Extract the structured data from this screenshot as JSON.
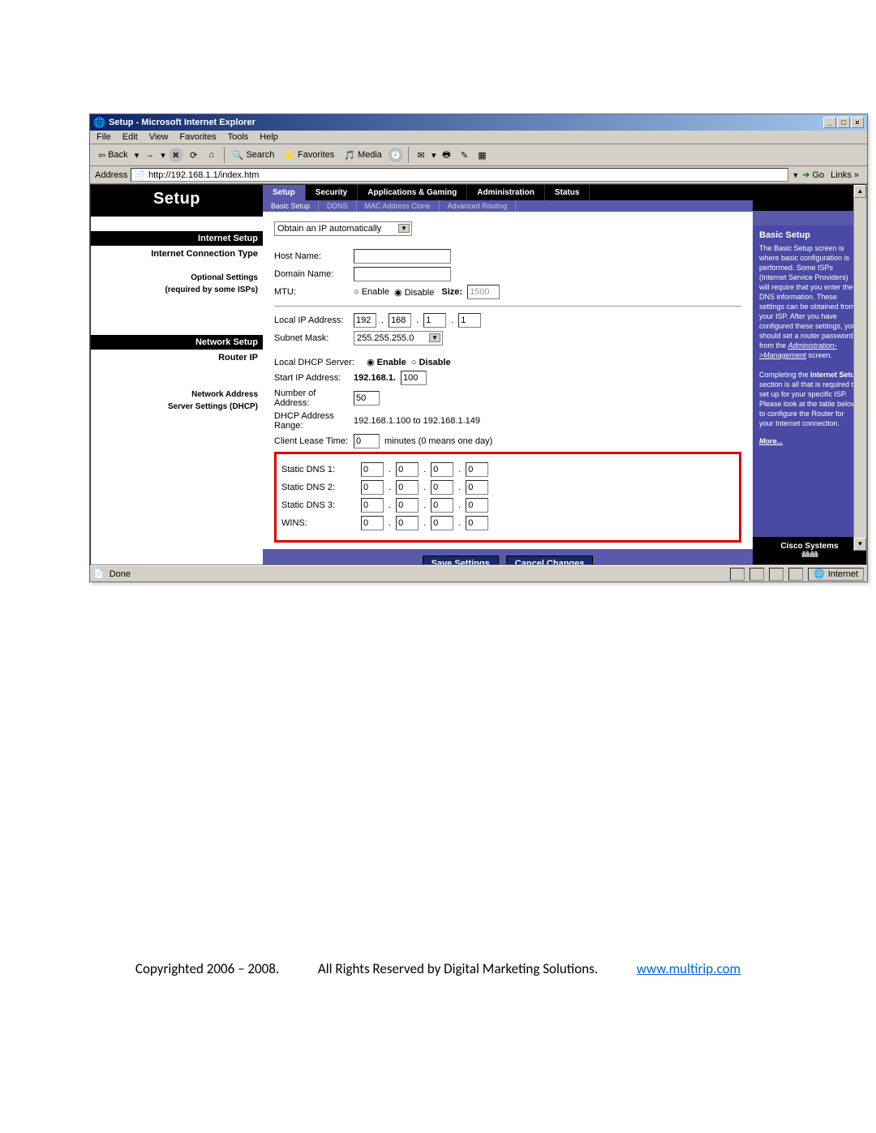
{
  "window": {
    "title": "Setup - Microsoft Internet Explorer",
    "min": "_",
    "max": "□",
    "close": "×"
  },
  "menu": {
    "file": "File",
    "edit": "Edit",
    "view": "View",
    "favorites": "Favorites",
    "tools": "Tools",
    "help": "Help"
  },
  "toolbar": {
    "back": "Back",
    "search": "Search",
    "favorites": "Favorites",
    "media": "Media"
  },
  "address": {
    "label": "Address",
    "url": "http://192.168.1.1/index.htm",
    "go": "Go",
    "links": "Links »"
  },
  "left": {
    "setup": "Setup",
    "internet_setup": "Internet Setup",
    "conn_type": "Internet Connection Type",
    "optional": "Optional Settings",
    "optional2": "(required by some ISPs)",
    "network_setup": "Network Setup",
    "router_ip": "Router IP",
    "net_addr": "Network Address",
    "dhcp": "Server Settings (DHCP)"
  },
  "tabs": {
    "setup": "Setup",
    "security": "Security",
    "apps": "Applications & Gaming",
    "admin": "Administration",
    "status": "Status"
  },
  "subtabs": {
    "basic": "Basic Setup",
    "ddns": "DDNS",
    "mac": "MAC Address Clone",
    "adv": "Advanced Routing"
  },
  "mid": {
    "obtain": "Obtain an IP automatically",
    "host": "Host Name:",
    "domain": "Domain Name:",
    "mtu": "MTU:",
    "enable": "Enable",
    "disable": "Disable",
    "size": "Size:",
    "mtu_size": "1500",
    "local_ip": "Local IP Address:",
    "ip1": "192",
    "ip2": "168",
    "ip3": "1",
    "ip4": "1",
    "subnet": "Subnet Mask:",
    "mask": "255.255.255.0",
    "dhcp_server": "Local DHCP Server:",
    "start_ip": "Start IP Address:",
    "start_prefix": "192.168.1.",
    "start_val": "100",
    "num_addr": "Number of Address:",
    "num_val": "50",
    "dhcp_range": "DHCP Address Range:",
    "range_val": "192.168.1.100  to  192.168.1.149",
    "lease": "Client Lease Time:",
    "lease_val": "0",
    "lease_note": "minutes (0 means one day)",
    "dns1": "Static DNS 1:",
    "dns2": "Static DNS 2:",
    "dns3": "Static DNS 3:",
    "wins": "WINS:",
    "zero": "0",
    "save": "Save Settings",
    "cancel": "Cancel Changes"
  },
  "help": {
    "title": "Basic Setup",
    "p1": "The Basic Setup screen is where basic configuration is performed. Some ISPs (Internet Service Providers) will require that you enter the DNS information. These settings can be obtained from your ISP. After you have configured these settings, you should set a router password from the ",
    "p1b": "Administration->Management",
    "p1c": " screen.",
    "p2a": "Completing the ",
    "p2b": "Internet Setup",
    "p2c": " section is all that is required to set up for your specific ISP. Please look at the table below to configure the Router for your Internet connection.",
    "more": "More...",
    "cisco": "Cisco Systems"
  },
  "status": {
    "done": "Done",
    "internet": "Internet"
  },
  "footer": {
    "copy": "Copyrighted 2006 – 2008.",
    "rights": "All Rights Reserved by Digital Marketing Solutions.",
    "link": "www.multirip.com"
  }
}
